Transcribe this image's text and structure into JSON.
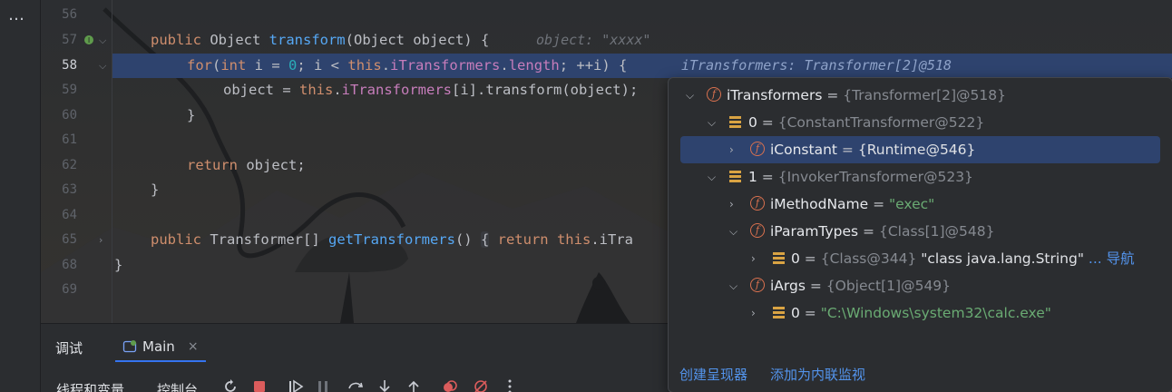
{
  "sidebar": {
    "more_icon": "…"
  },
  "editor": {
    "lines": [
      {
        "n": "56"
      },
      {
        "n": "57",
        "code_a": "public",
        "code_b": " Object ",
        "code_c": "transform",
        "code_d": "(Object object) {",
        "hint": "object: \"xxxx\""
      },
      {
        "n": "58",
        "code_a": "for",
        "code_b": "(",
        "code_c": "int",
        "code_d": " i = ",
        "code_e": "0",
        "code_f": "; i < ",
        "code_g": "this",
        "code_h": ".",
        "code_i": "iTransformers",
        "code_j": ".",
        "code_k": "length",
        "code_l": "; ++i) {",
        "hint": "iTransformers: Transformer[2]@518"
      },
      {
        "n": "59",
        "code_a": "object = ",
        "code_b": "this",
        "code_c": ".",
        "code_d": "iTransformers",
        "code_e": "[i].transform(object);"
      },
      {
        "n": "60",
        "code_a": "}"
      },
      {
        "n": "61"
      },
      {
        "n": "62",
        "code_a": "return",
        "code_b": " object;"
      },
      {
        "n": "63",
        "code_a": "}"
      },
      {
        "n": "64"
      },
      {
        "n": "65",
        "code_a": "public",
        "code_b": " Transformer[] ",
        "code_c": "getTransformers",
        "code_d": "() ",
        "code_e": "{",
        "code_f": " return",
        "code_g": " this",
        "code_h": ".iTra"
      },
      {
        "n": "68",
        "code_a": "}"
      },
      {
        "n": "69"
      }
    ]
  },
  "debug_panel": {
    "title": "调试",
    "session_tab": "Main",
    "close": "×",
    "threads_tab": "线程和变量",
    "console_tab": "控制台"
  },
  "popup": {
    "rows": [
      {
        "name": "iTransformers",
        "eq": " = ",
        "type": "{Transformer[2]@518}"
      },
      {
        "name": "0",
        "eq": " = ",
        "type": "{ConstantTransformer@522}"
      },
      {
        "name": "iConstant",
        "eq": " = ",
        "type": "{Runtime@546}"
      },
      {
        "name": "1",
        "eq": " = ",
        "type": "{InvokerTransformer@523}"
      },
      {
        "name": "iMethodName",
        "eq": " = ",
        "value": "\"exec\""
      },
      {
        "name": "iParamTypes",
        "eq": " = ",
        "type": "{Class[1]@548}"
      },
      {
        "name": "0",
        "eq": " = ",
        "type": "{Class@344}",
        "value": " \"class java.lang.String\"",
        "link": " ... 导航"
      },
      {
        "name": "iArgs",
        "eq": " = ",
        "type": "{Object[1]@549}"
      },
      {
        "name": "0",
        "eq": " = ",
        "value": "\"C:\\Windows\\system32\\calc.exe\""
      }
    ],
    "create_renderer": "创建呈现器",
    "add_inline_watch": "添加为内联监视"
  },
  "colors": {
    "accent": "#3574f0",
    "selection": "#2e436e",
    "keyword": "#cf8e6d",
    "function": "#56a8f5",
    "field": "#c77dbb",
    "number": "#2aacb8",
    "string": "#6aab73"
  }
}
